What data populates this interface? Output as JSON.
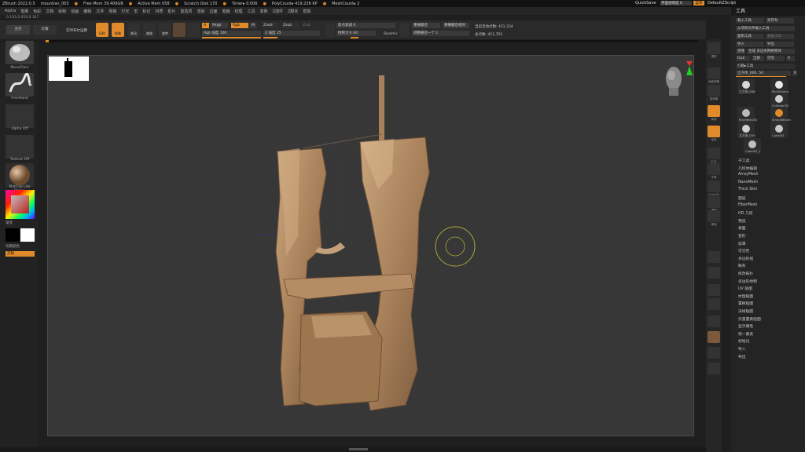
{
  "titlebar": {
    "app": "ZBrush 2022.0.5",
    "file": "mountian_003",
    "free_mem": "Free Mem 39.406GB",
    "active_mem": "Active Mem 658",
    "scratch_disk": "Scratch Disk 170",
    "timer": "Timer▸ 0.006",
    "poly_count": "PolyCount▸ 419.236 KP",
    "mesh_count": "MeshCount▸ 2",
    "quicksave": "QuickSave",
    "ui_transparency": "界面透明度 0",
    "menu_btn": "菜单",
    "default_script": "DefaultZScript"
  },
  "menubar": [
    "Alpha",
    "笔刷",
    "色彩",
    "文档",
    "绘制",
    "动画",
    "编辑",
    "文件",
    "规格",
    "灯光",
    "宏",
    "标记",
    "材质",
    "影片",
    "首选项",
    "渲染",
    "边面",
    "笔触",
    "纹理",
    "工具",
    "变换",
    "Z插件",
    "Z脚本",
    "帮助"
  ],
  "coords": "0.193,0.059,0.347",
  "toolbar": {
    "home": "主页",
    "lightbox": "灯箱",
    "live_boolean": "实时布尔运算",
    "edit": "Edit",
    "draw": "绘制",
    "move": "移动",
    "scale": "缩放",
    "rotate": "旋转",
    "a": "A",
    "mrgb": "Mrgb",
    "rgb": "Rgb",
    "m": "M",
    "zadd": "Zadd",
    "zsub": "Zsub",
    "zcut": "Zcut",
    "rgb_intensity": "Rgb 强度 100",
    "z_intensity": "Z 强度 25",
    "focal_shift": "焦点衰减 0",
    "draw_size": "绘制大小 64",
    "dynamic": "Dynamic",
    "replay_last": "重播最后",
    "replay_last_rel": "重播最后相对",
    "adjust_last": "调整最后一个 1",
    "active_points": "当前活动点数: 411,334",
    "total_points": "总点数: 411,762"
  },
  "leftshelf": {
    "brush1": "MoveFlare",
    "brush2": "FreeHand",
    "alpha": "Alpha Off",
    "texture": "Texture Off",
    "material": "MatCap Lite Brown",
    "gradient": "渐变",
    "switch_color": "切换颜色",
    "alternate": "交替"
  },
  "rightshelf": [
    "透视",
    "地面网格",
    "抠网格",
    "局部",
    "坐标",
    "汇合",
    "平移",
    "Line Fill",
    "透明",
    "单独"
  ],
  "palette": {
    "title": "工具",
    "load_tool": "载入工具",
    "save_as": "另存为",
    "load_from_project": "从项目文件载入工具",
    "copy_tool": "复制工具",
    "paste_tool": "粘贴工具",
    "import": "导入",
    "export": "导出",
    "clone": "克隆",
    "make_polymesh": "生成 多边形网格物体",
    "goz": "GoZ",
    "all": "全部",
    "visible": "可见",
    "r": "R",
    "lightbox_tools": "灯箱▸工具",
    "current_tool": "立方体_006. 50",
    "tools": [
      "立方体_006",
      "PolySphere",
      "Cylinder3D",
      "PolyMesh3D",
      "SimpleBrush",
      "立方体_009",
      "Cube3D",
      "Cube3D_1"
    ],
    "subpalettes": [
      "子工具",
      "几何体编辑",
      "ArrayMesh",
      "NanoMesh",
      "Thick Skin",
      "图层",
      "FiberMesh",
      "HD 几何",
      "预览",
      "表面",
      "变形",
      "遮罩",
      "可见性",
      "多边形组",
      "联系",
      "修改拓扑",
      "多边形绘制",
      "UV 贴图",
      "纹理贴图",
      "置换贴图",
      "法线贴图",
      "矢量置换贴图",
      "显示属性",
      "统一蒙皮",
      "初始化",
      "导入",
      "导出"
    ]
  },
  "colors": {
    "accent": "#e08a2b",
    "clay": "#b48a62",
    "canvas": "#373737"
  }
}
